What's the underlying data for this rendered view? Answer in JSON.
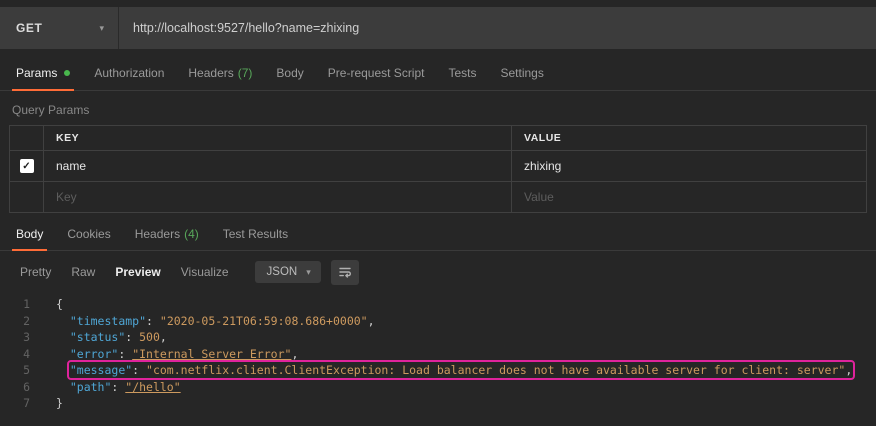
{
  "request": {
    "method": "GET",
    "url": "http://localhost:9527/hello?name=zhixing",
    "tabs": {
      "params": "Params",
      "authorization": "Authorization",
      "headers": "Headers",
      "headers_count": "(7)",
      "body": "Body",
      "prerequest": "Pre-request Script",
      "tests": "Tests",
      "settings": "Settings"
    }
  },
  "params_section": {
    "title": "Query Params",
    "col_key": "KEY",
    "col_value": "VALUE",
    "row": {
      "key": "name",
      "value": "zhixing",
      "checked": true
    },
    "placeholder": {
      "key": "Key",
      "value": "Value"
    }
  },
  "response": {
    "tabs": {
      "body": "Body",
      "cookies": "Cookies",
      "headers": "Headers",
      "headers_count": "(4)",
      "test_results": "Test Results"
    },
    "modes": {
      "pretty": "Pretty",
      "raw": "Raw",
      "preview": "Preview",
      "visualize": "Visualize"
    },
    "format": "JSON"
  },
  "colors": {
    "accent_orange": "#ff6c37",
    "success_green": "#49b84d",
    "highlight_magenta": "#df239c",
    "json_key_blue": "#4fa6d5",
    "json_string_orange": "#cd9a5f"
  },
  "code": {
    "lines": [
      {
        "n": 1,
        "tokens": [
          [
            "pu",
            "{"
          ]
        ]
      },
      {
        "n": 2,
        "tokens": [
          [
            "ind",
            "  "
          ],
          [
            "key",
            "\"timestamp\""
          ],
          [
            "pu",
            ": "
          ],
          [
            "str",
            "\"2020-05-21T06:59:08.686+0000\""
          ],
          [
            "pu",
            ","
          ]
        ]
      },
      {
        "n": 3,
        "tokens": [
          [
            "ind",
            "  "
          ],
          [
            "key",
            "\"status\""
          ],
          [
            "pu",
            ": "
          ],
          [
            "num",
            "500"
          ],
          [
            "pu",
            ","
          ]
        ]
      },
      {
        "n": 4,
        "tokens": [
          [
            "ind",
            "  "
          ],
          [
            "key",
            "\"error\""
          ],
          [
            "pu",
            ": "
          ],
          [
            "stru",
            "\"Internal Server Error\""
          ],
          [
            "pu",
            ","
          ]
        ]
      },
      {
        "n": 5,
        "hl": true,
        "tokens": [
          [
            "ind",
            "  "
          ],
          [
            "key",
            "\"message\""
          ],
          [
            "pu",
            ": "
          ],
          [
            "str",
            "\"com.netflix.client.ClientException: Load balancer does not have available server for client: server\""
          ],
          [
            "pu",
            ","
          ]
        ]
      },
      {
        "n": 6,
        "tokens": [
          [
            "ind",
            "  "
          ],
          [
            "key",
            "\"path\""
          ],
          [
            "pu",
            ": "
          ],
          [
            "stru",
            "\"/hello\""
          ]
        ]
      },
      {
        "n": 7,
        "tokens": [
          [
            "pu",
            "}"
          ]
        ]
      }
    ]
  }
}
